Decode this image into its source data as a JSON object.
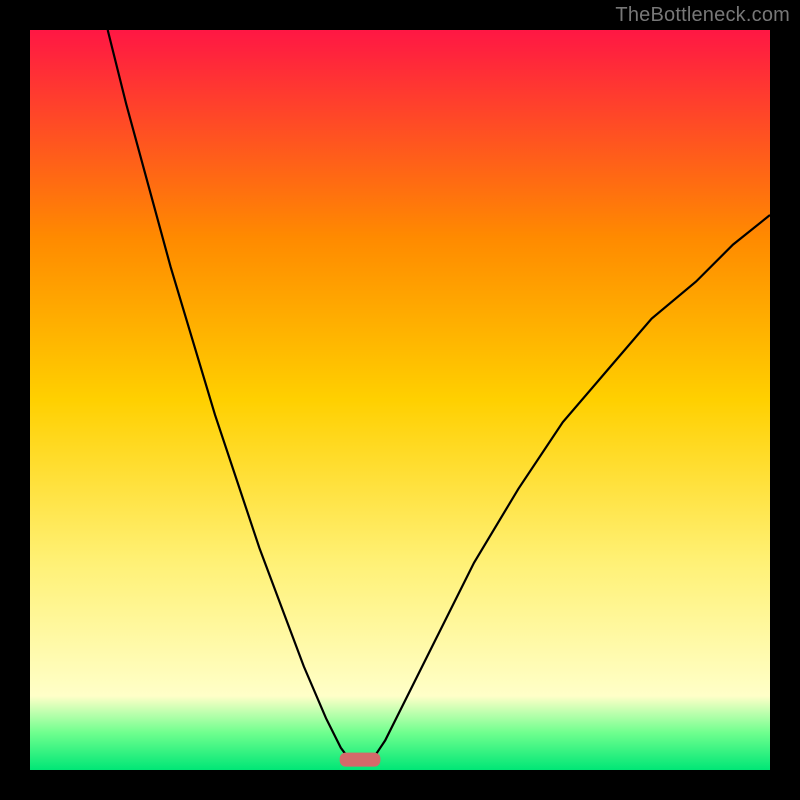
{
  "watermark": "TheBottleneck.com",
  "colors": {
    "frame": "#000000",
    "grad_top": "#ff1744",
    "grad_mid1": "#ff8a00",
    "grad_mid2": "#ffd000",
    "grad_mid3": "#fff176",
    "grad_low": "#ffffc8",
    "grad_green1": "#6eff8e",
    "grad_green2": "#00e676",
    "curve": "#000000",
    "marker": "#d46a6a"
  },
  "chart_data": {
    "type": "line",
    "title": "",
    "xlabel": "",
    "ylabel": "",
    "xlim": [
      0,
      100
    ],
    "ylim": [
      0,
      100
    ],
    "note": "Two curves descending to a common minimum near x≈44, y≈0; left branch reaches y=100 at x≈10.5, right branch reaches y≈75 at x=100. Values estimated from pixels.",
    "series": [
      {
        "name": "left-branch",
        "x": [
          10.5,
          13,
          16,
          19,
          22,
          25,
          28,
          31,
          34,
          37,
          40,
          42,
          43.5
        ],
        "y": [
          100,
          90,
          79,
          68,
          58,
          48,
          39,
          30,
          22,
          14,
          7,
          3,
          1
        ]
      },
      {
        "name": "right-branch",
        "x": [
          46,
          48,
          51,
          55,
          60,
          66,
          72,
          78,
          84,
          90,
          95,
          100
        ],
        "y": [
          1,
          4,
          10,
          18,
          28,
          38,
          47,
          54,
          61,
          66,
          71,
          75
        ]
      }
    ],
    "marker": {
      "x_center": 44.6,
      "width": 5.5,
      "y": 1.4
    }
  }
}
